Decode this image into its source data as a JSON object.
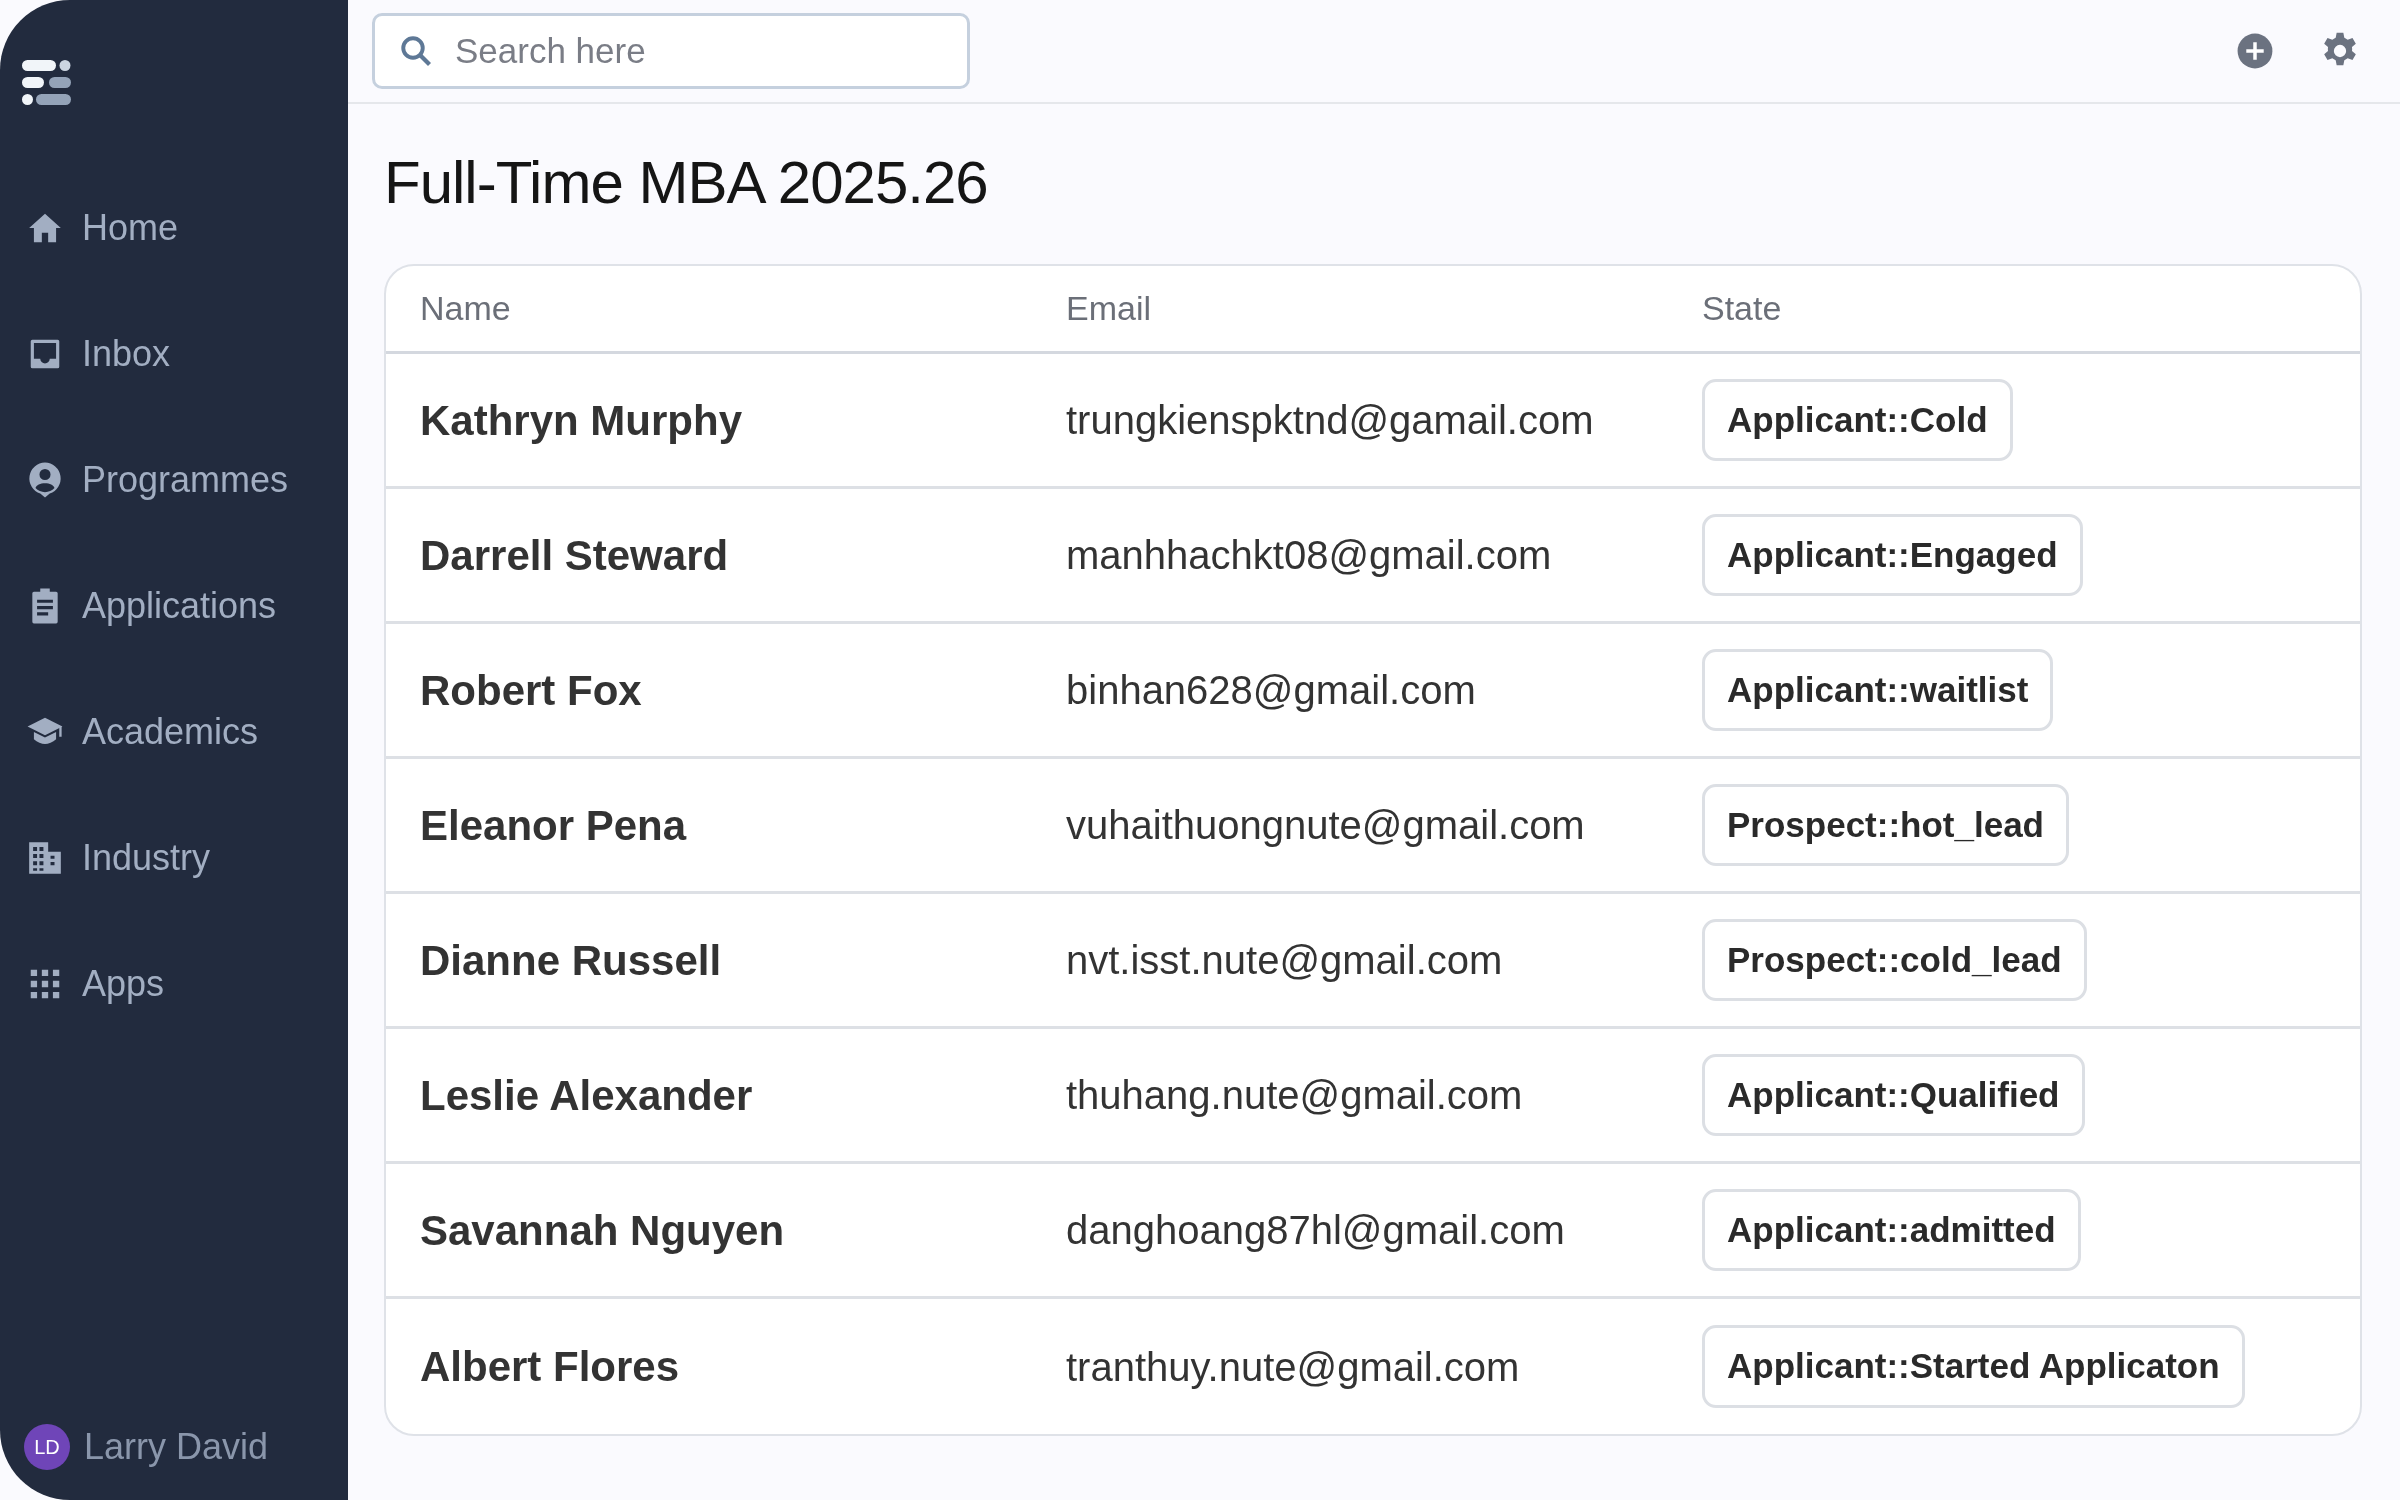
{
  "sidebar": {
    "items": [
      {
        "label": "Home"
      },
      {
        "label": "Inbox"
      },
      {
        "label": "Programmes"
      },
      {
        "label": "Applications"
      },
      {
        "label": "Academics"
      },
      {
        "label": "Industry"
      },
      {
        "label": "Apps"
      }
    ],
    "user": {
      "initials": "LD",
      "name": "Larry David"
    }
  },
  "search": {
    "placeholder": "Search here"
  },
  "page": {
    "title": "Full-Time MBA 2025.26"
  },
  "table": {
    "columns": [
      "Name",
      "Email",
      "State"
    ],
    "rows": [
      {
        "name": "Kathryn Murphy",
        "email": "trungkienspktnd@gamail.com",
        "state": "Applicant::Cold"
      },
      {
        "name": "Darrell Steward",
        "email": "manhhachkt08@gmail.com",
        "state": "Applicant::Engaged"
      },
      {
        "name": "Robert Fox",
        "email": "binhan628@gmail.com",
        "state": "Applicant::waitlist"
      },
      {
        "name": "Eleanor Pena",
        "email": "vuhaithuongnute@gmail.com",
        "state": "Prospect::hot_lead"
      },
      {
        "name": "Dianne Russell",
        "email": "nvt.isst.nute@gmail.com",
        "state": "Prospect::cold_lead"
      },
      {
        "name": "Leslie Alexander",
        "email": "thuhang.nute@gmail.com",
        "state": "Applicant::Qualified"
      },
      {
        "name": "Savannah Nguyen",
        "email": "danghoang87hl@gmail.com",
        "state": "Applicant::admitted"
      },
      {
        "name": "Albert Flores",
        "email": "tranthuy.nute@gmail.com",
        "state": "Applicant::Started Applicaton"
      }
    ]
  }
}
